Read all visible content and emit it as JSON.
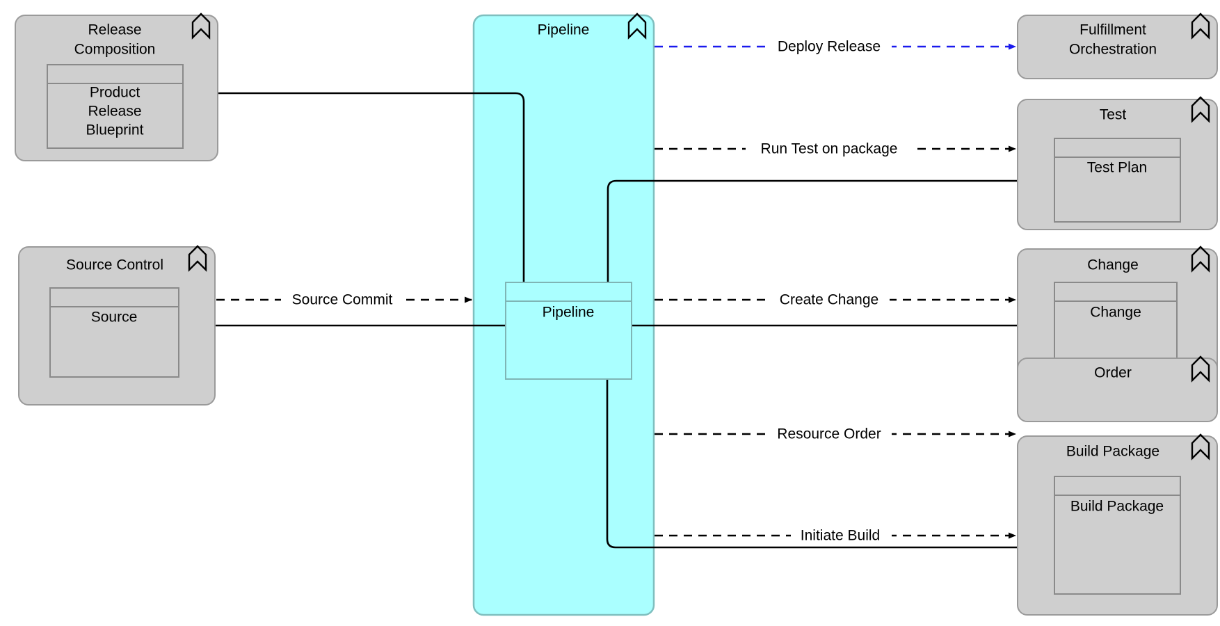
{
  "diagram": {
    "title": "Pipeline",
    "colors": {
      "node_fill": "#cfcfcf",
      "node_stroke": "#9a9a9a",
      "group_fill": "#aaffff",
      "group_stroke": "#7fbfbf",
      "flow_black": "#000000",
      "flow_blue": "#1a1aee",
      "canvas": "#ffffff"
    }
  },
  "group": {
    "label": "Pipeline",
    "icon": "chevron-up-icon",
    "inner": {
      "label": "Pipeline",
      "icon": "application-component-icon"
    }
  },
  "nodes": [
    {
      "id": "release-composition",
      "label": "Release Composition",
      "label_line1": "Release",
      "label_line2": "Composition",
      "icon": "chevron-up-icon",
      "inner": {
        "label": "Product Release Blueprint",
        "label_line1": "Product",
        "label_line2": "Release",
        "label_line3": "Blueprint"
      }
    },
    {
      "id": "source-control",
      "label": "Source Control",
      "icon": "chevron-up-icon",
      "inner": {
        "label": "Source"
      }
    },
    {
      "id": "fulfillment-orchestration",
      "label": "Fulfillment Orchestration",
      "label_line1": "Fulfillment",
      "label_line2": "Orchestration",
      "icon": "chevron-up-icon",
      "inner": null
    },
    {
      "id": "test",
      "label": "Test",
      "icon": "chevron-up-icon",
      "inner": {
        "label": "Test Plan"
      }
    },
    {
      "id": "change",
      "label": "Change",
      "icon": "chevron-up-icon",
      "inner": {
        "label": "Change"
      }
    },
    {
      "id": "order",
      "label": "Order",
      "icon": "chevron-up-icon",
      "inner": null
    },
    {
      "id": "build-package",
      "label": "Build Package",
      "icon": "chevron-up-icon",
      "inner": {
        "label": "Build Package"
      }
    }
  ],
  "edges": [
    {
      "id": "deploy-release",
      "label": "Deploy Release",
      "style": "dashed-arrow",
      "color": "#1a1aee",
      "from": "pipeline",
      "to": "fulfillment-orchestration"
    },
    {
      "id": "run-test-on-package",
      "label": "Run Test on package",
      "style": "dashed-arrow",
      "color": "#000000",
      "from": "pipeline",
      "to": "test"
    },
    {
      "id": "source-commit",
      "label": "Source Commit",
      "style": "dashed-arrow",
      "color": "#000000",
      "from": "source-control",
      "to": "pipeline"
    },
    {
      "id": "create-change",
      "label": "Create Change",
      "style": "dashed-arrow",
      "color": "#000000",
      "from": "pipeline",
      "to": "change"
    },
    {
      "id": "resource-order",
      "label": "Resource Order",
      "style": "dashed-arrow",
      "color": "#000000",
      "from": "pipeline",
      "to": "order"
    },
    {
      "id": "initiate-build",
      "label": "Initiate Build",
      "style": "dashed-arrow",
      "color": "#000000",
      "from": "pipeline",
      "to": "build-package"
    },
    {
      "id": "blueprint-to-pipeline",
      "label": "",
      "style": "solid",
      "color": "#000000",
      "from": "release-composition",
      "to": "pipeline"
    },
    {
      "id": "source-to-pipeline",
      "label": "",
      "style": "solid",
      "color": "#000000",
      "from": "source-control",
      "to": "pipeline"
    },
    {
      "id": "pipeline-to-test-plan",
      "label": "",
      "style": "solid",
      "color": "#000000",
      "from": "pipeline",
      "to": "test"
    },
    {
      "id": "pipeline-to-change",
      "label": "",
      "style": "solid",
      "color": "#000000",
      "from": "pipeline",
      "to": "change"
    },
    {
      "id": "pipeline-to-build-package",
      "label": "",
      "style": "solid",
      "color": "#000000",
      "from": "pipeline",
      "to": "build-package"
    }
  ]
}
